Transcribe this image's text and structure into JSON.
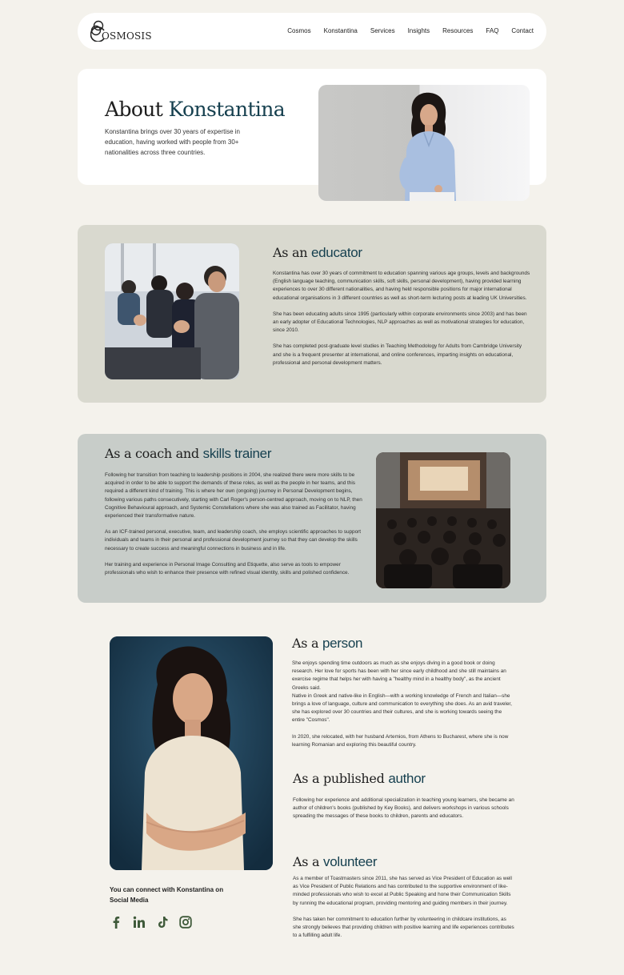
{
  "brand": {
    "logo_text": "OSMOSIS",
    "logo_initial": "C"
  },
  "nav": [
    "Cosmos",
    "Konstantina",
    "Services",
    "Insights",
    "Resources",
    "FAQ",
    "Contact"
  ],
  "hero": {
    "title_prefix": "About",
    "title_accent": "Konstantina",
    "intro": "Konstantina brings over 30 years of expertise in education, having worked with people from 30+ nationalities across three countries."
  },
  "educator": {
    "title_prefix": "As an",
    "title_accent": "educator",
    "paragraphs": [
      "Konstantina has over 30 years of commitment to education spanning various age groups, levels and backgrounds (English language teaching, communication skills, soft skills, personal development), having provided learning experiences to over 30 different nationalities, and having held responsible positions for major international educational organisations in 3 different countries as well as short-term lecturing posts at leading UK Universities.",
      "She has been educating adults since 1995 (particularly within corporate environments since 2003) and has been an early adopter of Educational Technologies, NLP approaches as well as motivational strategies for education, since 2010.",
      "She has completed post-graduate level studies in Teaching Methodology for Adults from Cambridge University and she is a frequent presenter at international, and online conferences, imparting insights on educational, professional and personal development matters."
    ]
  },
  "coach": {
    "title_prefix": "As a coach and",
    "title_accent": "skills trainer",
    "paragraphs": [
      "Following her transition from teaching to leadership positions in 2004, she realized there were more skills to be acquired in order to be able to support the demands of these roles, as well as the people in her teams, and this required a different kind of training. This is where her own (ongoing) journey in Personal Development begins, following various paths consecutively, starting with Carl Roger's person-centred approach, moving on to NLP, then Cognitive Behavioural approach, and Systemic Constellations where she was also trained as Facilitator, having experienced their transformative nature.",
      "As an ICF-trained personal, executive, team, and leadership coach, she employs scientific approaches to support individuals and teams in their personal and professional development journey so that they can develop the skills necessary to create success and meaningful connections in business and in life.",
      "Her training and experience in Personal Image Consulting and Etiquette, also serve as tools to empower professionals who wish to enhance their presence with refined visual identity, skills and polished confidence."
    ]
  },
  "person": {
    "title_prefix": "As a",
    "title_accent": "person",
    "paragraphs": [
      "She enjoys spending time outdoors as much as she enjoys diving in a good book or doing research. Her love for sports has been with her since early childhood and she still maintains an exercise regime that helps her with having a \"healthy mind in a healthy body\", as the ancient Greeks said.\nNative in Greek and native-like in English—with a working knowledge of French and Italian—she brings a love of language, culture and communication to everything she does. As an avid traveler, she has explored over 30 countries and their cultures, and she is working towards seeing the entire \"Cosmos\".",
      "In 2020, she relocated, with her husband Artemios, from Athens to Bucharest, where she is now learning Romanian and exploring this beautiful country."
    ]
  },
  "author": {
    "title_prefix": "As a published",
    "title_accent": "author",
    "paragraphs": [
      "Following her experience and additional specialization in teaching young learners, she became an author of children's books (published by Key Books), and delivers workshops in various schools spreading the messages of these books to children, parents and educators."
    ]
  },
  "volunteer": {
    "title_prefix": "As a",
    "title_accent": "volunteer",
    "paragraphs": [
      "As a member of Toastmasters since 2011, she has served as Vice President of Education as well as Vice President of Public Relations and has contributed to the supportive environment of like-minded professionals who wish to excel at Public Speaking and hone their Communication Skills by running the educational program, providing mentoring and guiding members in their journey.",
      "She has taken her commitment to education further by volunteering in childcare institutions, as she strongly believes that providing children with positive learning and life experiences contributes to a fulfilling adult life."
    ]
  },
  "social": {
    "label": "You can connect with Konstantina on Social Media",
    "icons": [
      "facebook-icon",
      "linkedin-icon",
      "tiktok-icon",
      "instagram-icon"
    ]
  },
  "colors": {
    "accent": "#16404f",
    "background": "#f4f2ec",
    "educator_bg": "#d9d9cf",
    "coach_bg": "#c8cdc9",
    "icon": "#3f5a3a"
  }
}
